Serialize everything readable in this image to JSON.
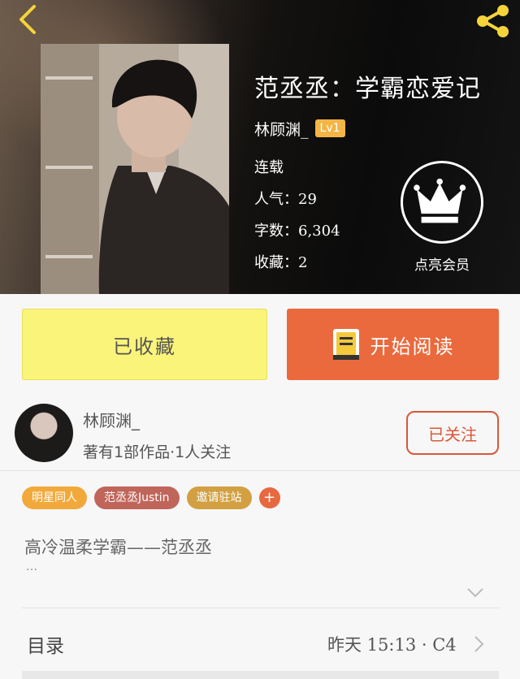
{
  "header": {
    "back_icon": "chevron-left-icon",
    "share_icon": "share-icon",
    "accent_color": "#f5d33a"
  },
  "book": {
    "title": "范丞丞：学霸恋爱记",
    "author": "林顾渊_",
    "level_badge": "Lv1",
    "status": "连载",
    "popularity": "人气：29",
    "word_count": "字数：6,304",
    "favorites": "收藏：2"
  },
  "vip": {
    "icon": "crown-icon",
    "label": "点亮会员"
  },
  "actions": {
    "favorited_label": "已收藏",
    "read_label": "开始阅读",
    "read_icon": "book-icon",
    "favorite_color": "#fbf47a",
    "read_color": "#ea6a3d"
  },
  "author_section": {
    "name": "林顾渊_",
    "info": "著有1部作品·1人关注",
    "follow_label": "已关注"
  },
  "tags": [
    {
      "label": "明星同人",
      "color": "#f2a93b"
    },
    {
      "label": "范丞丞Justin",
      "color": "#c0655a"
    },
    {
      "label": "邀请驻站",
      "color": "#d2a041"
    }
  ],
  "tag_add": "+",
  "description": {
    "text": "高冷温柔学霸——范丞丞",
    "ellipsis": "…"
  },
  "toc": {
    "label": "目录",
    "updated": "昨天 15:13 · C4"
  }
}
